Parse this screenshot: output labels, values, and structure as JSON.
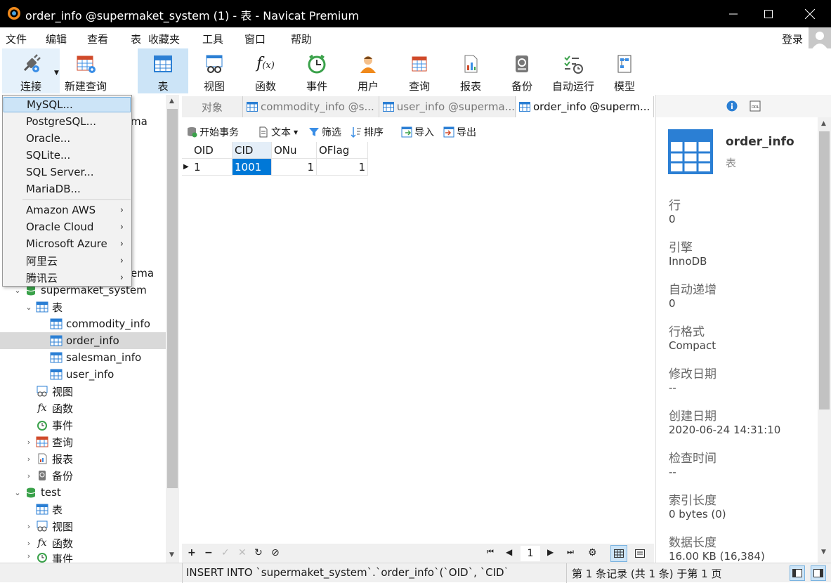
{
  "window": {
    "title": "order_info @supermaket_system (1) - 表 - Navicat Premium"
  },
  "menu": [
    "文件",
    "编辑",
    "查看",
    "表",
    "收藏夹",
    "工具",
    "窗口",
    "帮助"
  ],
  "login_label": "登录",
  "toolbar": [
    "连接",
    "新建查询",
    "表",
    "视图",
    "函数",
    "事件",
    "用户",
    "查询",
    "报表",
    "备份",
    "自动运行",
    "模型"
  ],
  "connect_menu": {
    "items": [
      "MySQL...",
      "PostgreSQL...",
      "Oracle...",
      "SQLite...",
      "SQL Server...",
      "MariaDB..."
    ],
    "cloud": [
      "Amazon AWS",
      "Oracle Cloud",
      "Microsoft Azure",
      "阿里云",
      "腾讯云"
    ]
  },
  "tree": {
    "partial_top": "ma",
    "partial_mid": "ema",
    "db1": "supermaket_system",
    "tables_label": "表",
    "tables": [
      "commodity_info",
      "order_info",
      "salesman_info",
      "user_info"
    ],
    "views": "视图",
    "functions": "函数",
    "events": "事件",
    "queries": "查询",
    "reports": "报表",
    "backups": "备份",
    "db2": "test",
    "db2_tables": "表",
    "db2_views": "视图",
    "db2_functions": "函数",
    "db2_events": "事件"
  },
  "tabs": [
    "对象",
    "commodity_info @s...",
    "user_info @superma...",
    "order_info @superm..."
  ],
  "subtoolbar": [
    "开始事务",
    "文本",
    "筛选",
    "排序",
    "导入",
    "导出"
  ],
  "grid": {
    "columns": [
      "OID",
      "CID",
      "ONu",
      "OFlag"
    ],
    "rows": [
      [
        "1",
        "1001",
        "1",
        "1"
      ]
    ]
  },
  "pager": {
    "page": "1"
  },
  "info": {
    "name": "order_info",
    "type": "表",
    "props": [
      {
        "label": "行",
        "value": "0"
      },
      {
        "label": "引擎",
        "value": "InnoDB"
      },
      {
        "label": "自动递增",
        "value": "0"
      },
      {
        "label": "行格式",
        "value": "Compact"
      },
      {
        "label": "修改日期",
        "value": "--"
      },
      {
        "label": "创建日期",
        "value": "2020-06-24 14:31:10"
      },
      {
        "label": "检查时间",
        "value": "--"
      },
      {
        "label": "索引长度",
        "value": "0 bytes (0)"
      },
      {
        "label": "数据长度",
        "value": "16.00 KB (16,384)"
      }
    ]
  },
  "status": {
    "sql": "INSERT INTO `supermaket_system`.`order_info`(`OID`, `CID`, `ON",
    "record": "第 1 条记录 (共 1 条) 于第 1 页"
  },
  "colors": {
    "accent": "#0078d7",
    "tab_active_bg": "#cce4f7"
  }
}
